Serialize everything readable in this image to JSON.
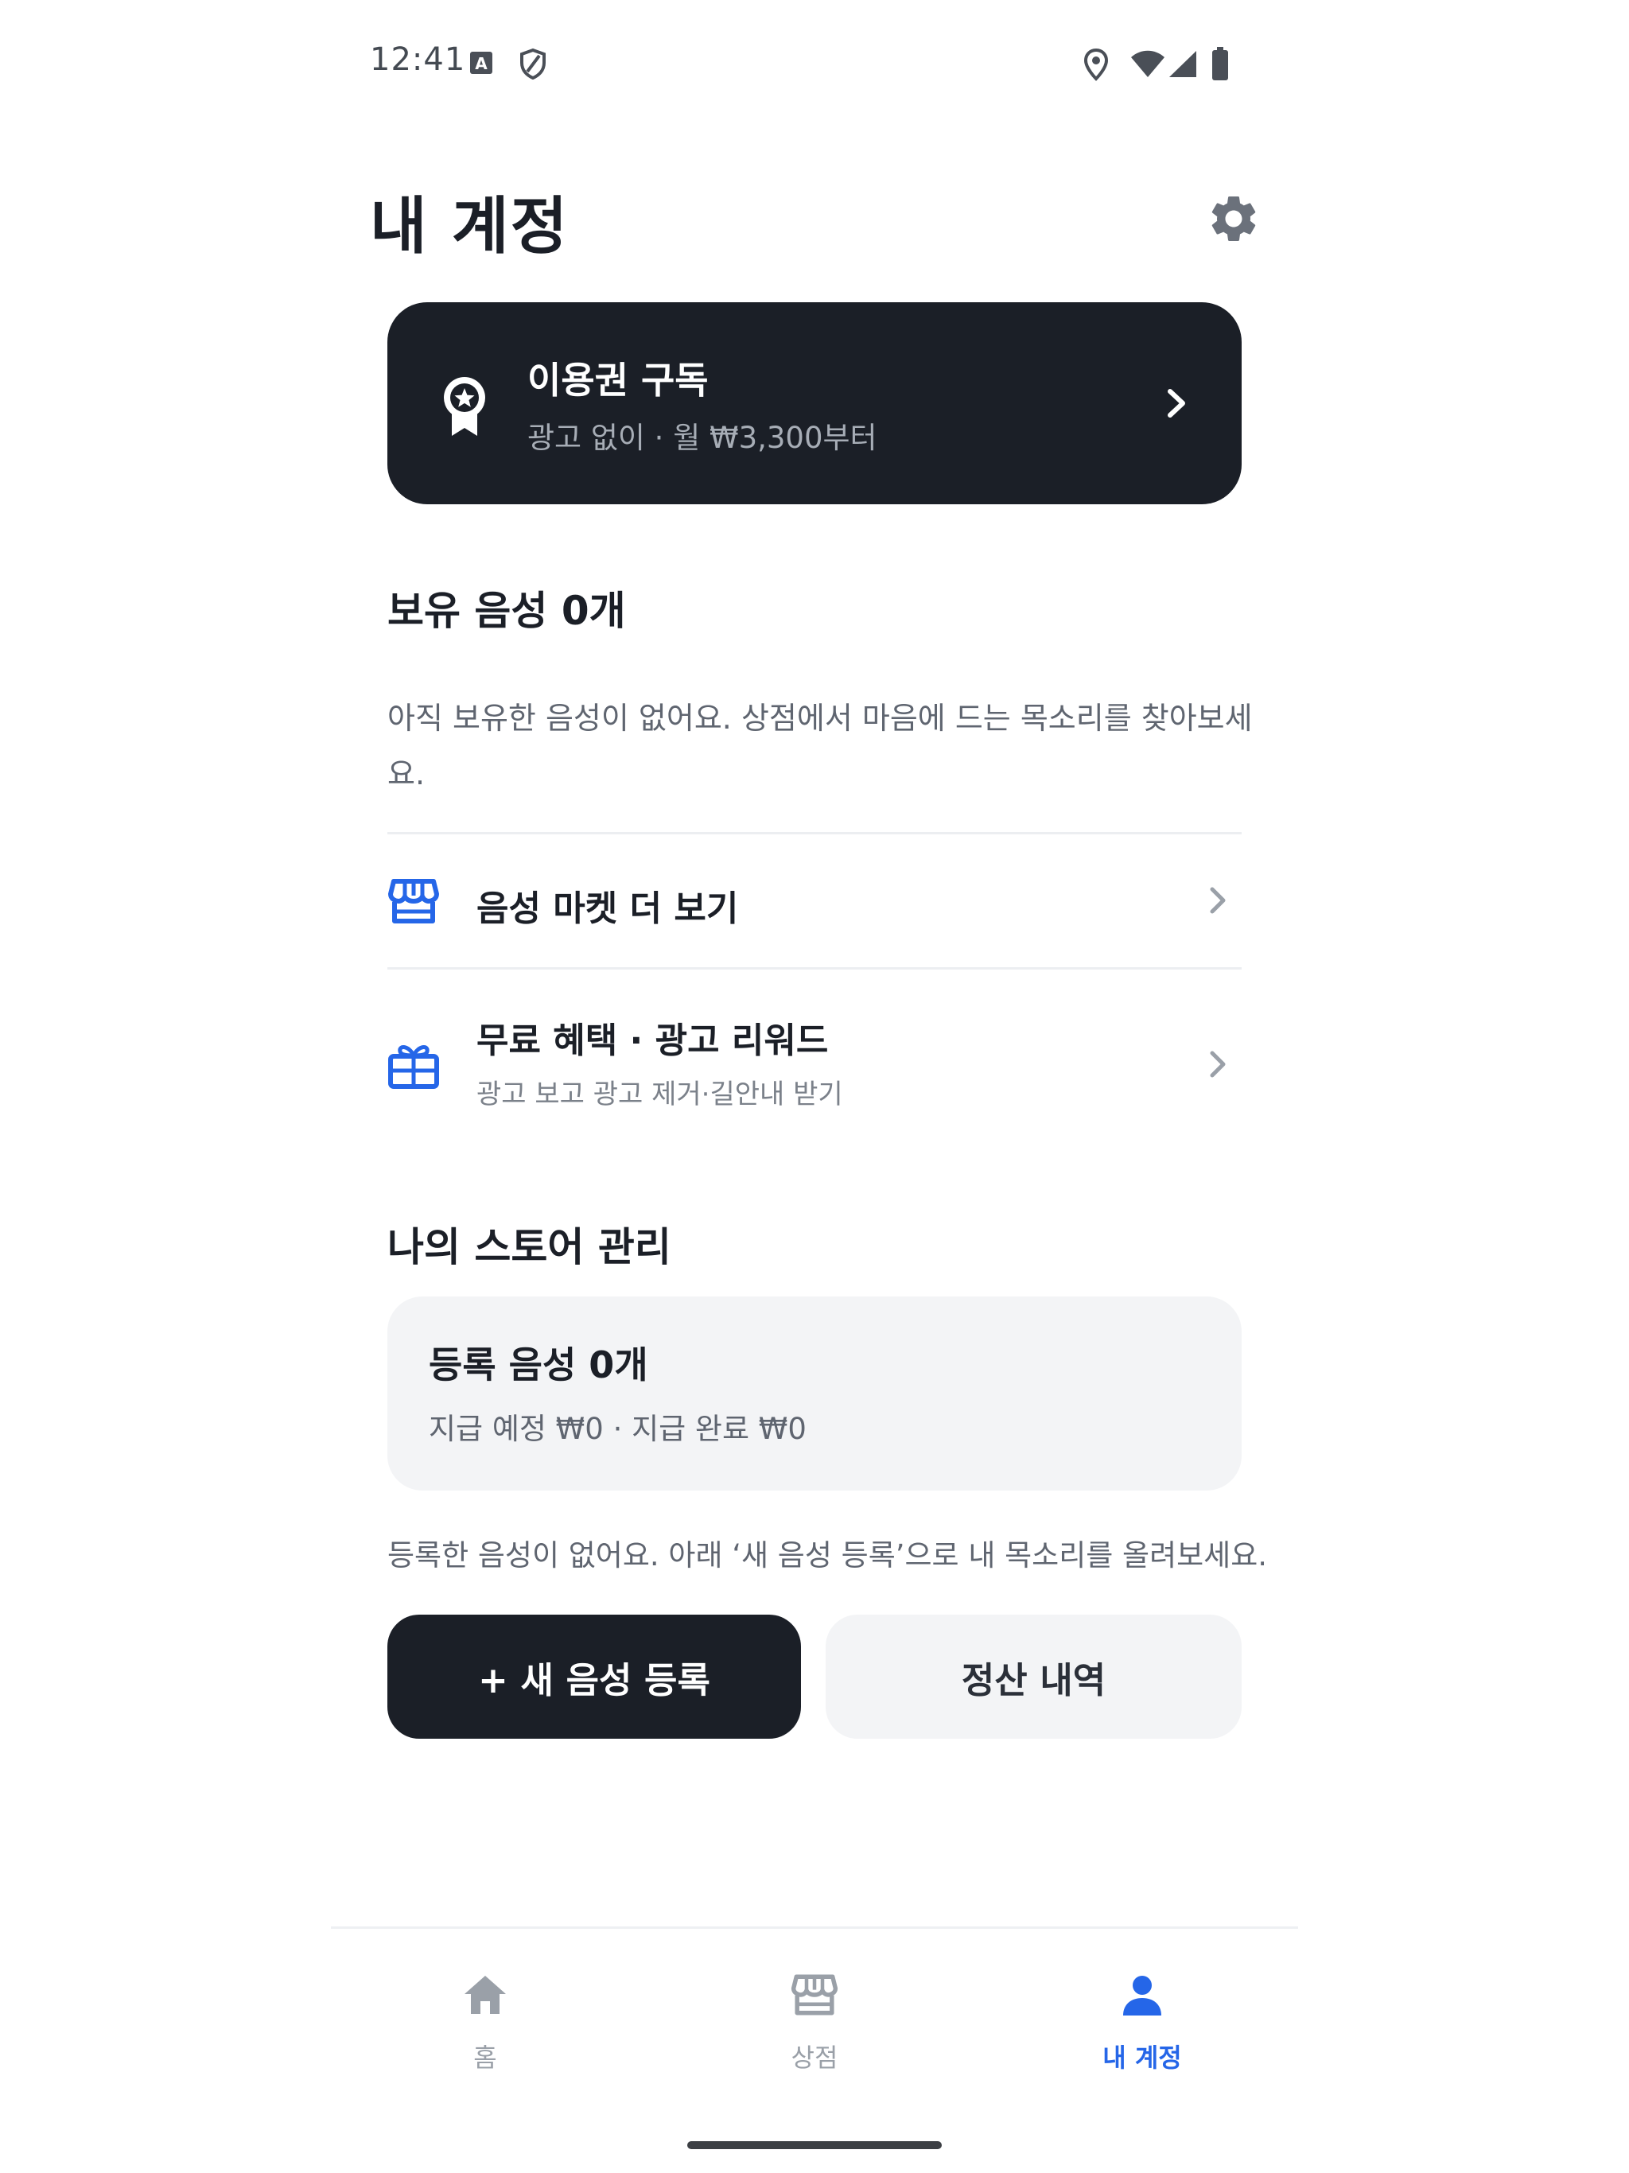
{
  "status_bar": {
    "time": "12:41",
    "icons": [
      "font-icon",
      "shield-icon",
      "location-icon",
      "wifi-icon",
      "signal-icon",
      "battery-icon"
    ]
  },
  "header": {
    "title": "내 계정",
    "settings_icon": "gear-icon"
  },
  "subscription_card": {
    "icon": "award-badge-icon",
    "title": "이용권 구독",
    "description": "광고 없이 · 월 ₩3,300부터"
  },
  "owned_voices": {
    "title": "보유 음성 0개",
    "empty_message": "아직 보유한 음성이 없어요. 상점에서 마음에 드는 목소리를 찾아보세요."
  },
  "menu": {
    "items": [
      {
        "icon": "store-icon",
        "label": "음성 마켓 더 보기",
        "subtitle": ""
      },
      {
        "icon": "gift-icon",
        "label": "무료 혜택 · 광고 리워드",
        "subtitle": "광고 보고 광고 제거·길안내 받기"
      }
    ]
  },
  "store_management": {
    "title": "나의 스토어 관리",
    "card_title": "등록 음성 0개",
    "card_desc": "지급 예정 ₩0 · 지급 완료 ₩0",
    "note": "등록한 음성이 없어요. 아래 ‘새 음성 등록’으로 내 목소리를 올려보세요.",
    "primary_button": "+ 새 음성 등록",
    "secondary_button": "정산 내역"
  },
  "bottom_nav": {
    "items": [
      {
        "icon": "home-icon",
        "label": "홈",
        "active": false
      },
      {
        "icon": "store-icon",
        "label": "상점",
        "active": false
      },
      {
        "icon": "person-icon",
        "label": "내 계정",
        "active": true
      }
    ]
  },
  "colors": {
    "primary_dark": "#1b1f27",
    "accent_blue": "#2566e8",
    "muted_gray": "#9aa0a8",
    "card_bg": "#f3f4f6"
  }
}
